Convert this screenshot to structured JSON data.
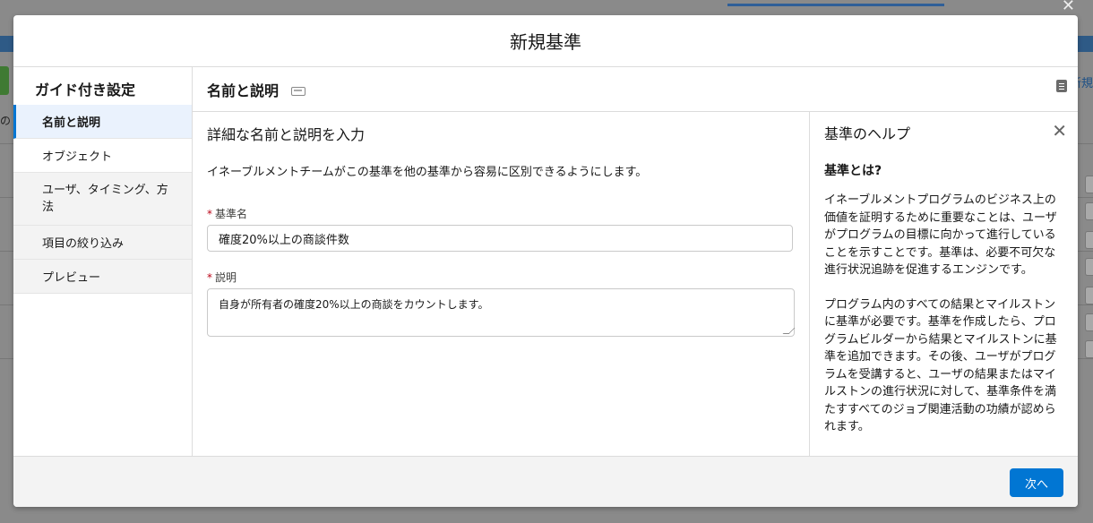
{
  "background": {
    "left_fragment": "の",
    "right_link": "新規"
  },
  "modal": {
    "title": "新規基準",
    "guide": {
      "title": "ガイド付き設定",
      "items": [
        {
          "label": "名前と説明"
        },
        {
          "label": "オブジェクト"
        },
        {
          "label": "ユーザ、タイミング、方法"
        },
        {
          "label": "項目の絞り込み"
        },
        {
          "label": "プレビュー"
        }
      ]
    },
    "section": {
      "title": "名前と説明"
    },
    "form": {
      "title": "詳細な名前と説明を入力",
      "description": "イネーブルメントチームがこの基準を他の基準から容易に区別できるようにします。",
      "required_mark": "*",
      "name_label": "基準名",
      "name_value": "確度20%以上の商談件数",
      "desc_label": "説明",
      "desc_value": "自身が所有者の確度20%以上の商談をカウントします。"
    },
    "help": {
      "title": "基準のヘルプ",
      "subtitle": "基準とは?",
      "p1": "イネーブルメントプログラムのビジネス上の価値を証明するために重要なことは、ユーザがプログラムの目標に向かって進行していることを示すことです。基準は、必要不可欠な進行状況追跡を促進するエンジンです。",
      "p2": "プログラム内のすべての結果とマイルストンに基準が必要です。基準を作成したら、プログラムビルダーから結果とマイルストンに基準を追加できます。その後、ユーザがプログラムを受講すると、ユーザの結果またはマイルストンの進行状況に対して、基準条件を満たすすべてのジョブ関連活動の功績が認められます。"
    },
    "footer": {
      "next_label": "次へ"
    }
  },
  "colors": {
    "brand": "#0176d3",
    "required": "#ba0517"
  }
}
